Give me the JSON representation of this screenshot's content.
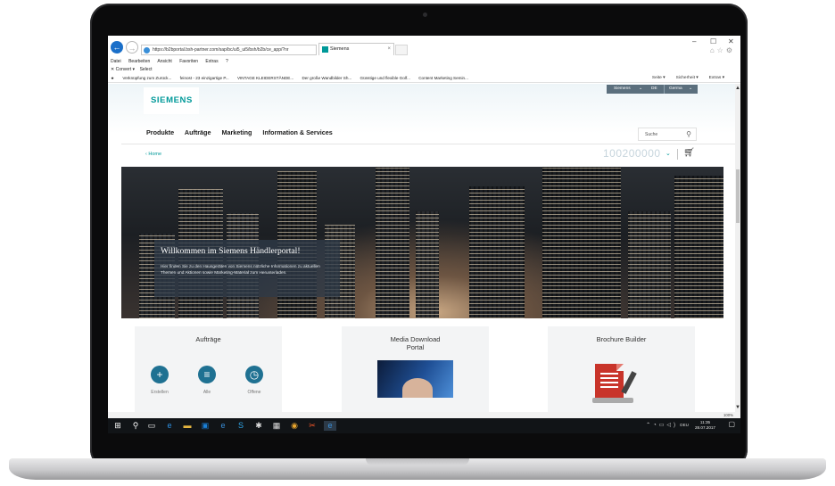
{
  "browser": {
    "address_url": "https://b2bportal.bsh-partner.com/sap/bc/ui5_ui5/bsh/b2b/ce_app/?nr",
    "tab_label": "Siemens",
    "tab_close": "×",
    "window_controls": [
      "–",
      "☐",
      "✕"
    ],
    "menu": [
      "Datei",
      "Bearbeiten",
      "Ansicht",
      "Favoriten",
      "Extras",
      "?"
    ],
    "commands": [
      "Convert ▾",
      "Select"
    ],
    "favorites": [
      "Verknüpfung zum Zurück...",
      "feinost - 23 einzigartige P...",
      "VINTAGE KLEIDERSTÄNDE...",
      "Der große Wandbilder Sh...",
      "Günstige und flexible Golf...",
      "Content Marketing Semin..."
    ],
    "toolbar_right": [
      "Seite ▾",
      "Sicherheit ▾",
      "Extras ▾"
    ]
  },
  "portal": {
    "logo": "SIEMENS",
    "brand_select": "Siemens",
    "lang_select": "DE",
    "country_select": "Germa",
    "nav": [
      "Produkte",
      "Aufträge",
      "Marketing",
      "Information & Services"
    ],
    "search_placeholder": "Suche",
    "breadcrumb": "‹ Home",
    "account_number": "100200000",
    "hero": {
      "title": "Willkommen im Siemens Händlerportal!",
      "text": "Hier finden Sie zu den Hausgeräten von Siemens nützliche Informationen zu aktuellen Themen und Aktionen sowie Marketing-Material zum Herunterladen."
    },
    "tiles": {
      "orders": {
        "title": "Aufträge",
        "actions": [
          "Erstellen",
          "Alle",
          "Offene"
        ]
      },
      "media": {
        "title": "Media Download Portal"
      },
      "brochure": {
        "title": "Brochure Builder"
      }
    }
  },
  "statusbar": {
    "zoom": "100%"
  },
  "taskbar": {
    "language": "DEU",
    "time": "11:35",
    "date": "28.07.2017"
  },
  "colors": {
    "brand": "#009999",
    "hero_caption": "#2e3a48",
    "taskbar": "#111417"
  }
}
